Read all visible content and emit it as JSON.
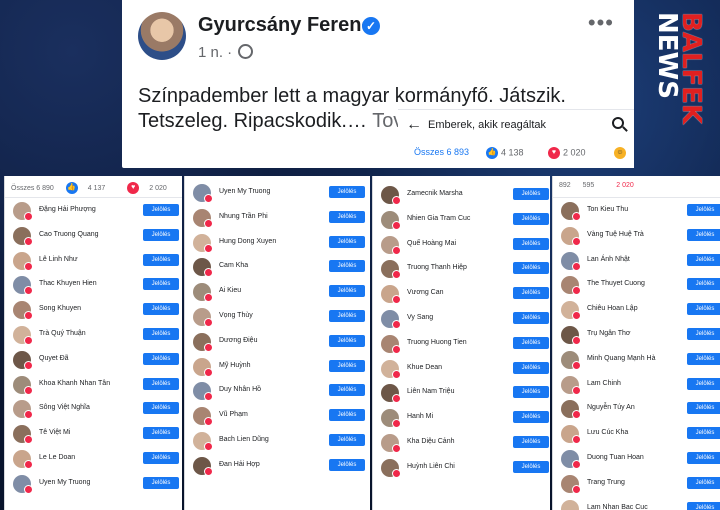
{
  "post": {
    "author": "Gyurcsány Ferenc",
    "verified_icon": "verified-badge-icon",
    "time": "1 n. ·",
    "more": "•••",
    "text": "Színpadember lett a magyar kormányfő. Játszik. Tetszeleg. Ripacskodik.…",
    "more_link": "Tovább"
  },
  "reactions_panel": {
    "back": "←",
    "title": "Emberek, akik reagáltak",
    "total_label": "Összes 6 893",
    "like_count": "4 138",
    "love_count": "2 020"
  },
  "logo": {
    "top": "BALFEK",
    "bottom": "NEWS"
  },
  "columns": [
    {
      "header": {
        "total": "Összes 6 890",
        "like": "4 137",
        "love": "2 020"
      },
      "button_label": "Jelölés",
      "names": [
        "Đặng Hải Phượng",
        "Cao Truong Quang",
        "Lê Linh Như",
        "Thac Khuyen Hien",
        "Song Khuyen",
        "Trà Quý Thuận",
        "Quyet Đã",
        "Khoa Khanh Nhan Tân",
        "Sông Việt Nghĩa",
        "Tê Việt Mi",
        "Le Le Doan",
        "Uyen My Truong"
      ]
    },
    {
      "header": {
        "total": "",
        "like": "",
        "love": ""
      },
      "button_label": "Jelölés",
      "names": [
        "Uyen My Truong",
        "Nhung Trần Phi",
        "Hung Dong Xuyen",
        "Cam Kha",
        "Ai Kieu",
        "Vọng Thùy",
        "Dương Điệu",
        "Mỹ Huỳnh",
        "Duy Nhân Hồ",
        "Vũ Phạm",
        "Bach Lien Dũng",
        "Đan Hải Hợp"
      ]
    },
    {
      "header": {
        "total": "",
        "like": "",
        "love": ""
      },
      "button_label": "Jelölés",
      "names": [
        "Zamecnik Marsha",
        "Nhien Gia Tram Cuc",
        "Quế Hoàng Mai",
        "Truong Thanh Hiệp",
        "Vương Can",
        "Vy Sang",
        "Truong Huong Tien",
        "Khue Dean",
        "Liên Nam Triệu",
        "Hanh Mi",
        "Kha Diệu Cảnh",
        "Huỳnh Liên Chi"
      ]
    },
    {
      "header": {
        "total": "892",
        "like": "595",
        "love": "2 020"
      },
      "button_label": "Jelölés",
      "names": [
        "Ton Kieu Thu",
        "Vàng Tuệ Huệ Trà",
        "Lan Ánh Nhật",
        "The Thuyet Cuong",
        "Chiêu Hoan Lập",
        "Trụ Ngân Thơ",
        "Minh Quang Mạnh Hà",
        "Lam Chinh",
        "Nguyễn Túy An",
        "Lưu Cúc Kha",
        "Duong Tuan Hoan",
        "Trang Trung",
        "Lam Nhan Bac Cuc"
      ]
    }
  ]
}
